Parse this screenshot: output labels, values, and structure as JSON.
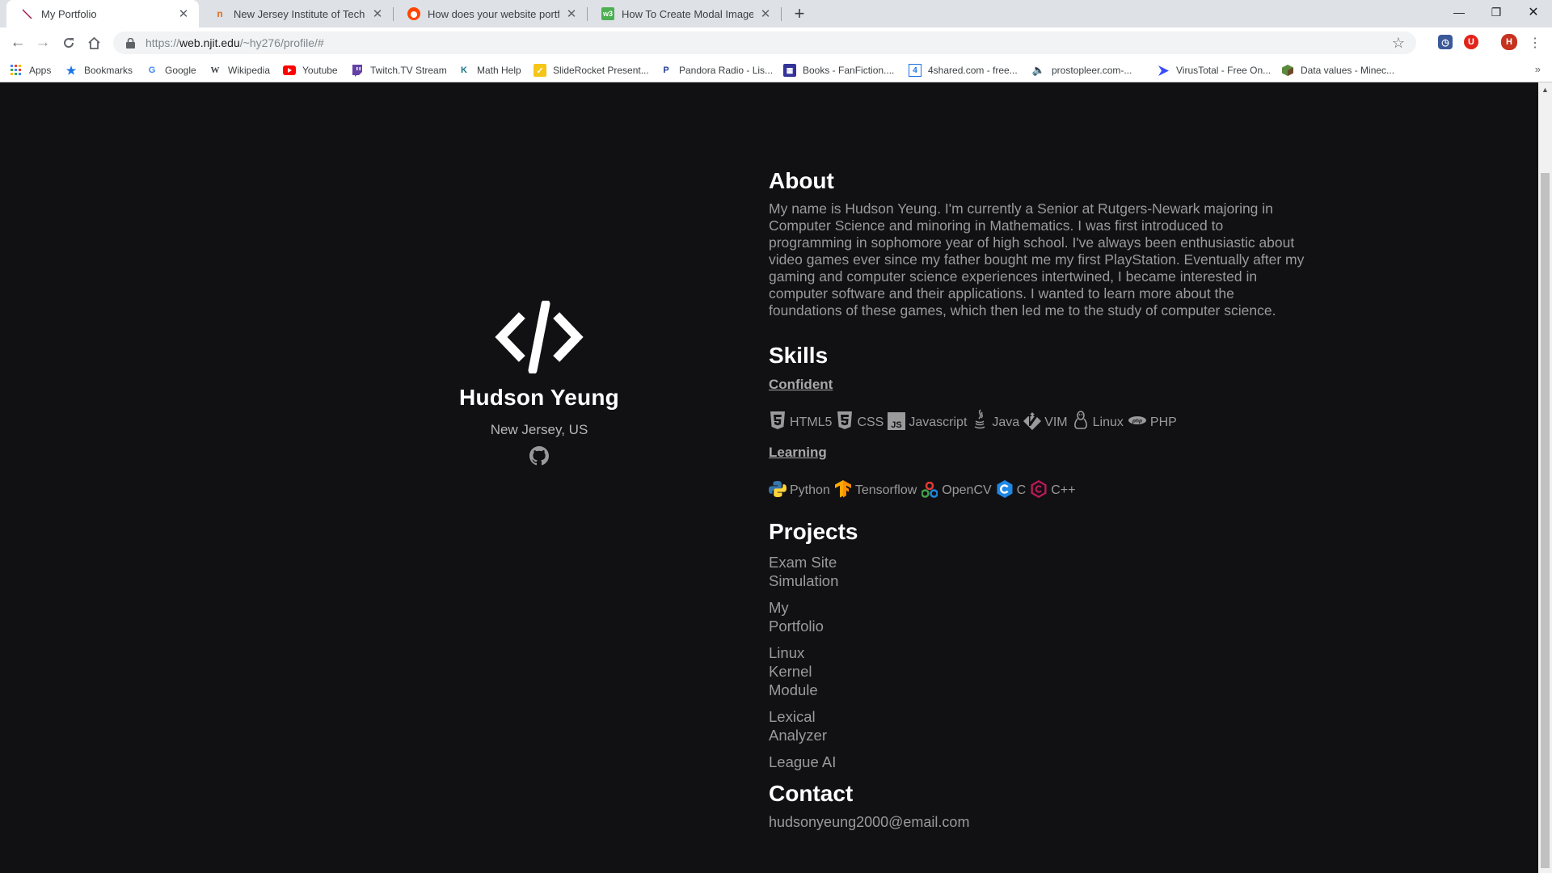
{
  "browser": {
    "tabs": [
      {
        "title": "My Portfolio",
        "active": true,
        "favicon": "portfolio-feather-icon"
      },
      {
        "title": "New Jersey Institute of Technolog",
        "active": false,
        "favicon": "njit-icon"
      },
      {
        "title": "How does your website portfolio",
        "active": false,
        "favicon": "reddit-icon"
      },
      {
        "title": "How To Create Modal Images",
        "active": false,
        "favicon": "w3schools-icon"
      }
    ],
    "url_scheme": "https://",
    "url_host": "web.njit.edu",
    "url_path": "/~hy276/profile/#",
    "profile_initial": "H",
    "bookmarks": [
      {
        "label": "Apps",
        "icon": "apps-grid-icon"
      },
      {
        "label": "Bookmarks",
        "icon": "star-icon"
      },
      {
        "label": "Google",
        "icon": "google-icon"
      },
      {
        "label": "Wikipedia",
        "icon": "wikipedia-icon"
      },
      {
        "label": "Youtube",
        "icon": "youtube-icon"
      },
      {
        "label": "Twitch.TV Stream",
        "icon": "twitch-icon"
      },
      {
        "label": "Math Help",
        "icon": "khan-icon"
      },
      {
        "label": "SlideRocket Present...",
        "icon": "sliderocket-icon"
      },
      {
        "label": "Pandora Radio - Lis...",
        "icon": "pandora-icon"
      },
      {
        "label": "Books - FanFiction....",
        "icon": "fanfiction-icon"
      },
      {
        "label": "4shared.com - free...",
        "icon": "4shared-icon"
      },
      {
        "label": "prostopleer.com-...",
        "icon": "speaker-icon"
      },
      {
        "label": "VirusTotal - Free On...",
        "icon": "virustotal-icon"
      },
      {
        "label": "Data values - Minec...",
        "icon": "minecraft-icon"
      }
    ],
    "bookmarks_overflow": "»"
  },
  "profile": {
    "name": "Hudson Yeung",
    "location": "New Jersey, US",
    "logo_icon": "code-slash-icon",
    "github_icon": "github-icon"
  },
  "about": {
    "heading": "About",
    "text": "My name is Hudson Yeung. I'm currently a Senior at Rutgers-Newark majoring in Computer Science and minoring in Mathematics. I was first introduced to programming in sophomore year of high school. I've always been enthusiastic about video games ever since my father bought me my first PlayStation. Eventually after my gaming and computer science experiences intertwined, I became interested in computer software and their applications. I wanted to learn more about the foundations of these games, which then led me to the study of computer science."
  },
  "skills": {
    "heading": "Skills",
    "confident_label": "Confident",
    "confident": [
      {
        "label": "HTML5",
        "icon": "html5-icon"
      },
      {
        "label": "CSS",
        "icon": "css3-icon"
      },
      {
        "label": "Javascript",
        "icon": "javascript-icon"
      },
      {
        "label": "Java",
        "icon": "java-icon"
      },
      {
        "label": "VIM",
        "icon": "vim-icon"
      },
      {
        "label": "Linux",
        "icon": "linux-icon"
      },
      {
        "label": "PHP",
        "icon": "php-icon"
      }
    ],
    "learning_label": "Learning",
    "learning": [
      {
        "label": "Python",
        "icon": "python-icon"
      },
      {
        "label": "Tensorflow",
        "icon": "tensorflow-icon"
      },
      {
        "label": "OpenCV",
        "icon": "opencv-icon"
      },
      {
        "label": "C",
        "icon": "c-icon"
      },
      {
        "label": "C++",
        "icon": "cpp-icon"
      }
    ]
  },
  "projects": {
    "heading": "Projects",
    "items": [
      "Exam Site Simulation",
      "My Portfolio",
      "Linux Kernel Module",
      "Lexical Analyzer",
      "League AI"
    ]
  },
  "contact": {
    "heading": "Contact",
    "email": "hudsonyeung2000@email.com"
  },
  "colors": {
    "page_background": "#111114",
    "heading": "#ffffff",
    "body_text": "#9a9a9a"
  }
}
